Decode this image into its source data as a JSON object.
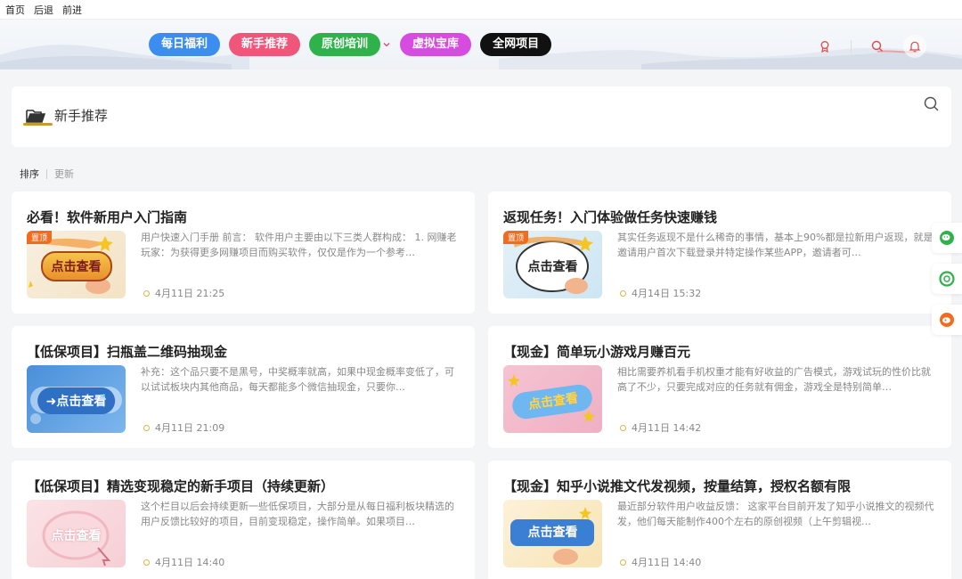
{
  "browser": {
    "home": "首页",
    "back": "后退",
    "forward": "前进"
  },
  "nav": {
    "pills": [
      {
        "label": "每日福利",
        "color": "#3b8ef0"
      },
      {
        "label": "新手推荐",
        "color": "#f0557a"
      },
      {
        "label": "原创培训",
        "color": "#2fb24a"
      },
      {
        "label": "虚拟宝库",
        "color": "#d64ce0"
      },
      {
        "label": "全网项目",
        "color": "#111111"
      }
    ]
  },
  "category": {
    "title": "新手推荐"
  },
  "sort": {
    "active": "排序",
    "option": "更新"
  },
  "posts": [
    {
      "title": "必看！软件新用户入门指南",
      "excerpt": "用户快速入门手册 前言： 软件用户主要由以下三类人群构成： 1. 网赚老玩家：为获得更多网赚项目而购买软件，仅仅是作为一个参考…",
      "date": "4月11日 21:25",
      "badge": "置顶",
      "thumb_text": "点击查看"
    },
    {
      "title": "返现任务！入门体验做任务快速赚钱",
      "excerpt": "其实任务返现不是什么稀奇的事情，基本上90%都是拉新用户返现，就是邀请用户首次下载登录并特定操作某些APP，邀请者可…",
      "date": "4月14日 15:32",
      "badge": "置顶",
      "thumb_text": "点击查看"
    },
    {
      "title": "【低保项目】扫瓶盖二维码抽现金",
      "excerpt": "补充：这个品只要不是黑号，中奖概率就高，如果中现金概率变低了，可以试试板块内其他商品，每天都能多个微信抽现金，只要你…",
      "date": "4月11日 21:09",
      "badge": "",
      "thumb_text": "➜点击查看"
    },
    {
      "title": "【现金】简单玩小游戏月赚百元",
      "excerpt": "相比需要养机看手机权重才能有好收益的广告模式，游戏试玩的性价比就高了不少，只要完成对应的任务就有佣金，游戏全是特别简单…",
      "date": "4月11日 14:42",
      "badge": "",
      "thumb_text": "点击查看"
    },
    {
      "title": "【低保项目】精选变现稳定的新手项目（持续更新）",
      "excerpt": "这个栏目以后会持续更新一些低保项目，大部分是从每日福利板块精选的用户反馈比较好的项目，目前变现稳定，操作简单。如果项目…",
      "date": "4月11日 14:40",
      "badge": "",
      "thumb_text": "点击查看"
    },
    {
      "title": "【现金】知乎小说推文代发视频，按量结算，授权名额有限",
      "excerpt": "最近部分软件用户收益反馈：        这家平台目前开发了知乎小说推文的视频代发，他们每天能制作400个左右的原创视频（上午剪辑视…",
      "date": "4月11日 14:40",
      "badge": "",
      "thumb_text": "点击查看"
    }
  ],
  "icons": {
    "award": "award-icon",
    "search": "search-icon",
    "bell": "bell-icon",
    "folder": "folder-open-icon",
    "wechat": "wechat-icon",
    "moments": "moments-icon",
    "weibo": "weibo-icon"
  }
}
